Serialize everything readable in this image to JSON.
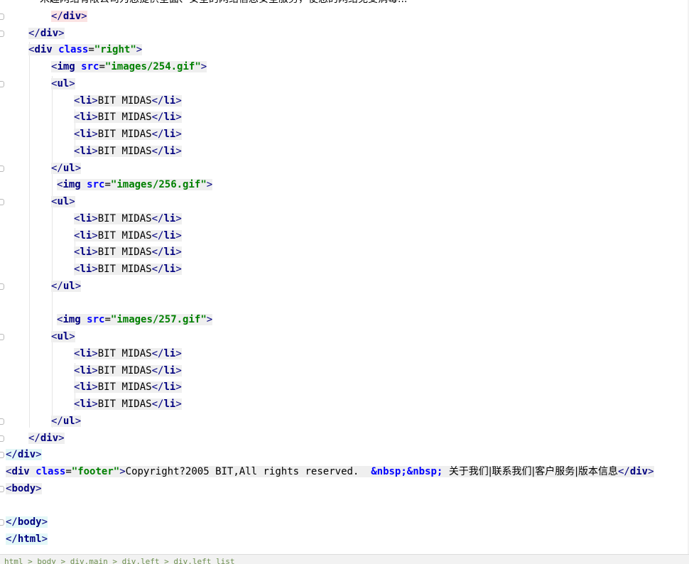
{
  "editor": {
    "lines": [
      {
        "segments": [
          "宋趣网络有限公司为您提供全面、安全的网络信息安全服务，使您的网络免受病毒..."
        ]
      },
      {
        "segments": [
          "</",
          "div",
          ">"
        ]
      },
      {
        "segments": [
          "</",
          "div",
          ">"
        ]
      },
      {
        "segments": [
          "<",
          "div",
          " ",
          "class",
          "=",
          "\"right\"",
          ">"
        ]
      },
      {
        "segments": [
          "<",
          "img",
          " ",
          "src",
          "=",
          "\"images/254.gif\"",
          ">"
        ]
      },
      {
        "segments": [
          "<",
          "ul",
          ">"
        ]
      },
      {
        "segments": [
          "<",
          "li",
          ">",
          "BIT MIDAS",
          "</",
          "li",
          ">"
        ]
      },
      {
        "segments": [
          "<",
          "li",
          ">",
          "BIT MIDAS",
          "</",
          "li",
          ">"
        ]
      },
      {
        "segments": [
          "<",
          "li",
          ">",
          "BIT MIDAS",
          "</",
          "li",
          ">"
        ]
      },
      {
        "segments": [
          "<",
          "li",
          ">",
          "BIT MIDAS",
          "</",
          "li",
          ">"
        ]
      },
      {
        "segments": [
          "</",
          "ul",
          ">"
        ]
      },
      {
        "segments": [
          "<",
          "img",
          " ",
          "src",
          "=",
          "\"images/256.gif\"",
          ">"
        ]
      },
      {
        "segments": [
          "<",
          "ul",
          ">"
        ]
      },
      {
        "segments": [
          "<",
          "li",
          ">",
          "BIT MIDAS",
          "</",
          "li",
          ">"
        ]
      },
      {
        "segments": [
          "<",
          "li",
          ">",
          "BIT MIDAS",
          "</",
          "li",
          ">"
        ]
      },
      {
        "segments": [
          "<",
          "li",
          ">",
          "BIT MIDAS",
          "</",
          "li",
          ">"
        ]
      },
      {
        "segments": [
          "<",
          "li",
          ">",
          "BIT MIDAS",
          "</",
          "li",
          ">"
        ]
      },
      {
        "segments": [
          "</",
          "ul",
          ">"
        ]
      },
      {
        "segments": [
          ""
        ]
      },
      {
        "segments": [
          "<",
          "img",
          " ",
          "src",
          "=",
          "\"images/257.gif\"",
          ">"
        ]
      },
      {
        "segments": [
          "<",
          "ul",
          ">"
        ]
      },
      {
        "segments": [
          "<",
          "li",
          ">",
          "BIT MIDAS",
          "</",
          "li",
          ">"
        ]
      },
      {
        "segments": [
          "<",
          "li",
          ">",
          "BIT MIDAS",
          "</",
          "li",
          ">"
        ]
      },
      {
        "segments": [
          "<",
          "li",
          ">",
          "BIT MIDAS",
          "</",
          "li",
          ">"
        ]
      },
      {
        "segments": [
          "<",
          "li",
          ">",
          "BIT MIDAS",
          "</",
          "li",
          ">"
        ]
      },
      {
        "segments": [
          "</",
          "ul",
          ">"
        ]
      },
      {
        "segments": [
          "</",
          "div",
          ">"
        ]
      },
      {
        "segments": [
          "</",
          "div",
          ">"
        ]
      },
      {
        "segments": [
          "<",
          "div",
          " ",
          "class",
          "=",
          "\"footer\"",
          ">",
          "Copyright?2005 BIT,All rights reserved.  ",
          "&nbsp;&nbsp;",
          " ",
          "关于我们|联系我们|客户服务|版本信息",
          "</",
          "div",
          ">"
        ]
      },
      {
        "segments": [
          "<",
          "body",
          ">"
        ]
      },
      {
        "segments": [
          ""
        ]
      },
      {
        "segments": [
          "</",
          "body",
          ">"
        ]
      },
      {
        "segments": [
          "</",
          "html",
          ">"
        ]
      }
    ]
  },
  "statusbar": {
    "breadcrumb": "html > body > div.main > div.left > div.left_list"
  }
}
